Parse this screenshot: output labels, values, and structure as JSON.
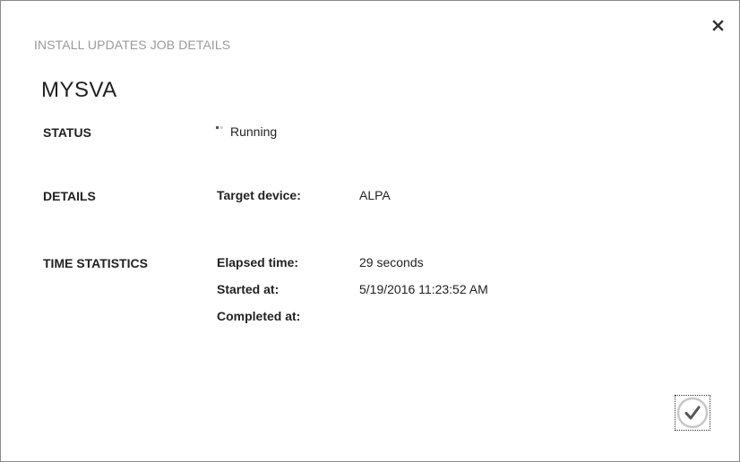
{
  "dialog": {
    "subtitle": "INSTALL UPDATES JOB DETAILS",
    "title": "MYSVA",
    "close_icon": "close-icon",
    "confirm_icon": "checkmark-icon"
  },
  "status": {
    "section_label": "STATUS",
    "value": "Running",
    "icon": "progress-spinner-icon"
  },
  "details": {
    "section_label": "DETAILS",
    "target_device_label": "Target device:",
    "target_device_value": "ALPA"
  },
  "time_statistics": {
    "section_label": "TIME STATISTICS",
    "elapsed_label": "Elapsed time:",
    "elapsed_value": "29 seconds",
    "started_label": "Started at:",
    "started_value": "5/19/2016 11:23:52 AM",
    "completed_label": "Completed at:",
    "completed_value": ""
  }
}
